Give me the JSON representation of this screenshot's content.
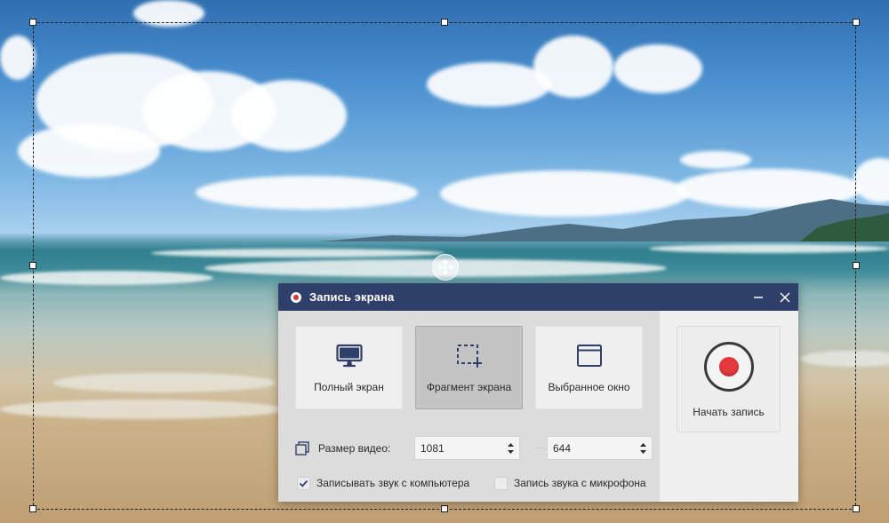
{
  "desktop": {
    "wallpaper": "beach-seascape",
    "colors": {
      "sky": "#4a8fcf",
      "sea": "#2f7f8f",
      "sand": "#cbb38c"
    }
  },
  "capture_area": {
    "move_icon": "move-arrows-icon"
  },
  "dialog": {
    "title": "Запись экрана",
    "title_icon": "record-icon",
    "minimize_icon": "minimize-icon",
    "close_icon": "close-icon",
    "colors": {
      "titlebar": "#2e3f6a",
      "record": "#e23a3f",
      "panel": "#dcdcdc"
    },
    "modes": [
      {
        "label": "Полный экран",
        "icon": "monitor-icon",
        "selected": false
      },
      {
        "label": "Фрагмент экрана",
        "icon": "selection-fragment-icon",
        "selected": true
      },
      {
        "label": "Выбранное окно",
        "icon": "window-icon",
        "selected": false
      }
    ],
    "video_size": {
      "label": "Размер видео:",
      "icon": "video-size-icon",
      "width": "1081",
      "height": "644"
    },
    "audio": {
      "computer_sound": {
        "label": "Записывать звук с компьютера",
        "checked": true
      },
      "microphone_sound": {
        "label": "Запись звука с микрофона",
        "checked": false
      }
    },
    "record_button": {
      "label": "Начать запись",
      "icon": "record-start-icon"
    }
  }
}
